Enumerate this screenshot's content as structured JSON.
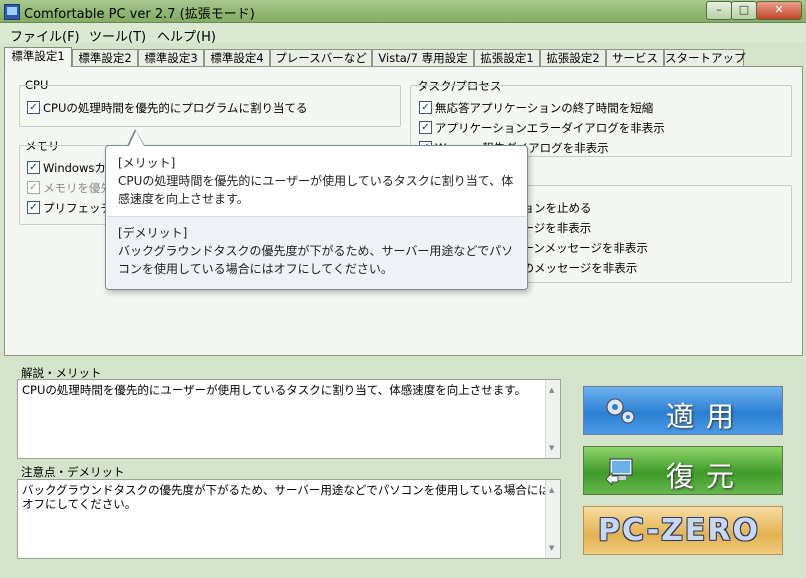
{
  "window": {
    "title": "Comfortable PC ver 2.7 (拡張モード)"
  },
  "menu": [
    "ファイル(F)",
    "ツール(T)",
    "ヘルプ(H)"
  ],
  "tabs": [
    "標準設定1",
    "標準設定2",
    "標準設定3",
    "標準設定4",
    "プレースバーなど",
    "Vista/7 専用設定",
    "拡張設定1",
    "拡張設定2",
    "サービス",
    "スタートアップ"
  ],
  "cpu": {
    "heading": "CPU",
    "item": {
      "label": "CPUの処理時間を優先的にプログラムに割り当てる",
      "checked": true
    }
  },
  "memory": {
    "heading": "メモリ",
    "items": [
      {
        "label": "Windowsカー",
        "checked": true,
        "disabled": false
      },
      {
        "label": "メモリを優先",
        "checked": true,
        "disabled": true
      },
      {
        "label": "プリフェッチを",
        "checked": true,
        "disabled": false
      }
    ]
  },
  "task": {
    "heading": "タスク/プロセス",
    "items": [
      {
        "label": "無応答アプリケーションの終了時間を短縮",
        "checked": true
      },
      {
        "label": "アプリケーションエラーダイアログを非表示",
        "checked": true
      },
      {
        "label": "W... ...ー報告ダイアログを非表示",
        "checked": true
      }
    ],
    "partial_items": [
      "ションを止める",
      "セージを非表示",
      "ルーンメッセージを非表示",
      "ーのメッセージを非表示"
    ]
  },
  "tooltip": {
    "merit_title": "[メリット]",
    "merit_body": "CPUの処理時間を優先的にユーザーが使用しているタスクに割り当て、体感速度を向上させます。",
    "demerit_title": "[デメリット]",
    "demerit_body": "バックグラウンドタスクの優先度が下がるため、サーバー用途などでパソコンを使用している場合にはオフにしてください。"
  },
  "description": {
    "label": "解説・メリット",
    "text": "CPUの処理時間を優先的にユーザーが使用しているタスクに割り当て、体感速度を向上させます。"
  },
  "caution": {
    "label": "注意点・デメリット",
    "text": "バックグラウンドタスクの優先度が下がるため、サーバー用途などでパソコンを使用している場合にはオフにしてください。"
  },
  "buttons": {
    "apply": "適用",
    "restore": "復元",
    "pczero": "PC-ZERO"
  },
  "colors": {
    "apply": "#2a7fd4",
    "restore": "#3f9b2a",
    "pczero": "#e4b250"
  }
}
